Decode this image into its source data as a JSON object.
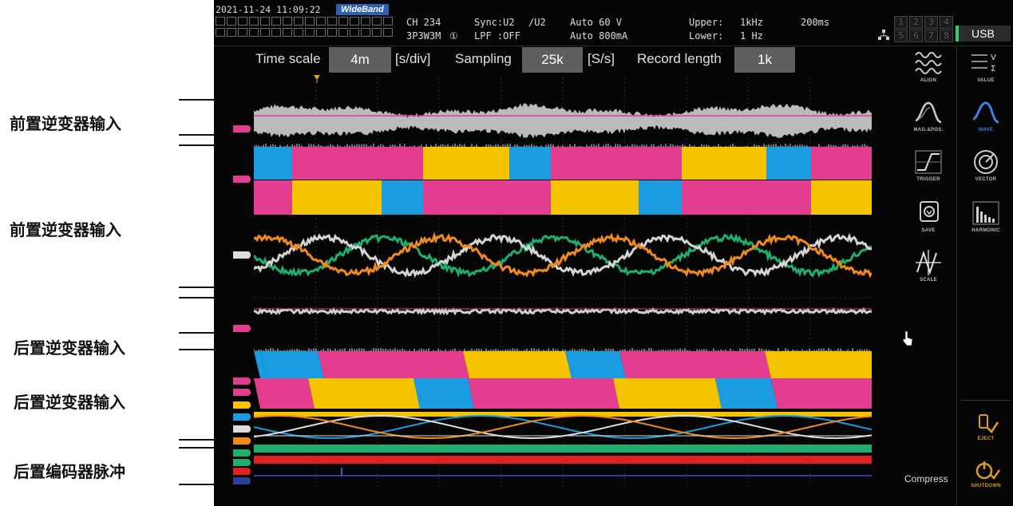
{
  "annotations": {
    "front_inverter_input": "前置逆变器输入",
    "rear_inverter_input": "后置逆变器输入",
    "rear_encoder_pulse": "后置编码器脉冲"
  },
  "status": {
    "datetime": "2021-11-24 11:09:22",
    "badge": "WideBand",
    "ch": "CH 234",
    "wiring": "3P3W3M",
    "wiring_num": "①",
    "sync": "Sync:U2",
    "sync2": "/U2",
    "lpf": "LPF :OFF",
    "range_v": "Auto  60 V",
    "range_a": "Auto 800mA",
    "upper": "Upper:",
    "upper_val": "1kHz",
    "lower": "Lower:",
    "lower_val": "1 Hz",
    "period": "200ms",
    "usb": "USB",
    "ch_numbers": [
      "1",
      "2",
      "3",
      "4",
      "5",
      "6",
      "7",
      "8"
    ]
  },
  "settings": {
    "time_scale_label": "Time scale",
    "time_scale_value": "4m",
    "time_scale_unit": "[s/div]",
    "sampling_label": "Sampling",
    "sampling_value": "25k",
    "sampling_unit": "[S/s]",
    "record_length_label": "Record length",
    "record_length_value": "1k"
  },
  "sidebar": {
    "align": "ALIGN",
    "mag_pos": "MAG.&POS.",
    "trigger": "TRIGGER",
    "save": "SAVE",
    "scale": "SCALE",
    "value": "VALUE",
    "wave": "WAVE",
    "vector": "VECTOR",
    "harmonic": "HARMONIC",
    "eject": "EJECT",
    "shutdown": "SHUTDOWN",
    "compress": "Compress"
  },
  "colors": {
    "pink": "#e23d8e",
    "yellow": "#f4c400",
    "blue": "#1b9be0",
    "green": "#1fae6e",
    "orange": "#f08a1c",
    "gray": "#c8c8c8",
    "red": "#e02020",
    "navy": "#2a3f9a",
    "accent_wave": "#3f7fe0"
  }
}
